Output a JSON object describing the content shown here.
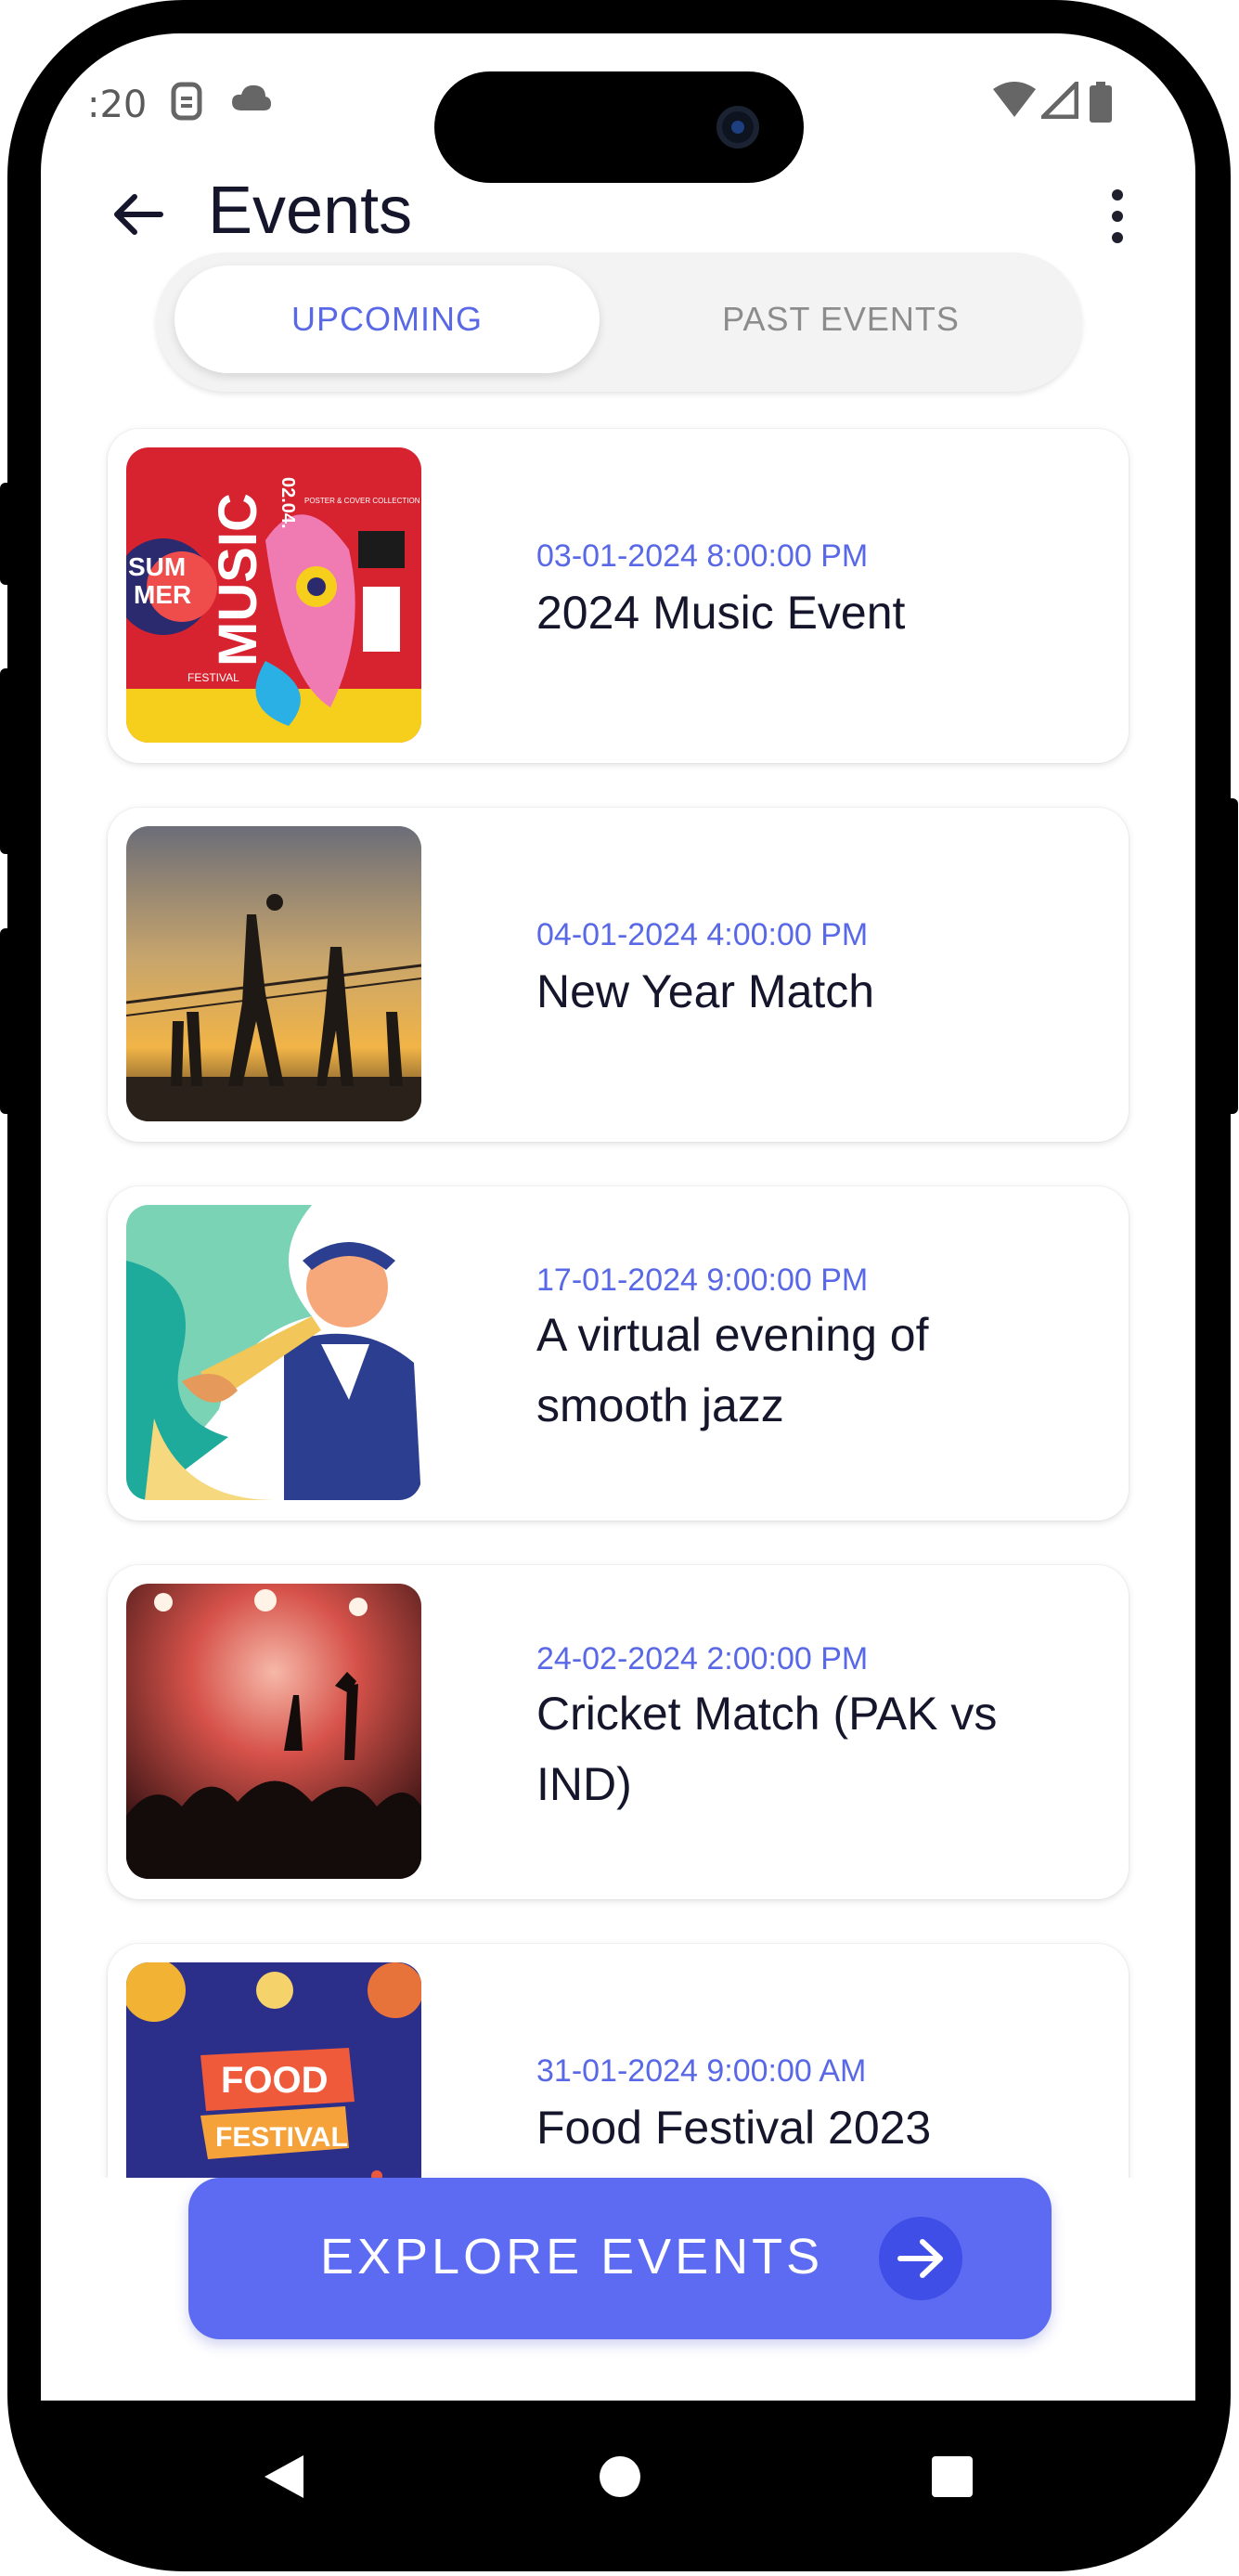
{
  "status_bar": {
    "time": ":20",
    "icons": [
      "sim-icon",
      "cloud-icon",
      "wifi-icon",
      "signal-icon",
      "battery-icon"
    ]
  },
  "header": {
    "title": "Events",
    "back_icon": "arrow-left-icon",
    "menu_icon": "more-vertical-icon"
  },
  "tabs": {
    "items": [
      {
        "label": "UPCOMING",
        "active": true
      },
      {
        "label": "PAST EVENTS",
        "active": false
      }
    ]
  },
  "events": [
    {
      "date": "03-01-2024 8:00:00 PM",
      "name": "2024 Music Event",
      "thumb_text_1": "SUM",
      "thumb_text_2": "MER",
      "thumb_text_3": "MUSIC",
      "thumb_text_4": "FESTIVAL",
      "thumb_text_5": "02.04.",
      "thumb_text_6": "POSTER & COVER COLLECTION"
    },
    {
      "date": "04-01-2024 4:00:00 PM",
      "name": "New Year Match"
    },
    {
      "date": "17-01-2024 9:00:00 PM",
      "name": "A virtual evening of smooth jazz"
    },
    {
      "date": "24-02-2024 2:00:00 PM",
      "name": "Cricket Match (PAK vs IND)"
    },
    {
      "date": "31-01-2024 9:00:00 AM",
      "name": "Food Festival 2023",
      "thumb_text_1": "FOOD",
      "thumb_text_2": "FESTIVAL"
    }
  ],
  "explore_button": {
    "label": "EXPLORE EVENTS",
    "icon": "arrow-right-icon"
  },
  "nav_bar": {
    "icons": [
      "back-triangle-icon",
      "home-circle-icon",
      "recents-square-icon"
    ]
  },
  "colors": {
    "accent": "#5d6bf2",
    "date_text": "#5968e6",
    "title_text": "#15162b"
  }
}
